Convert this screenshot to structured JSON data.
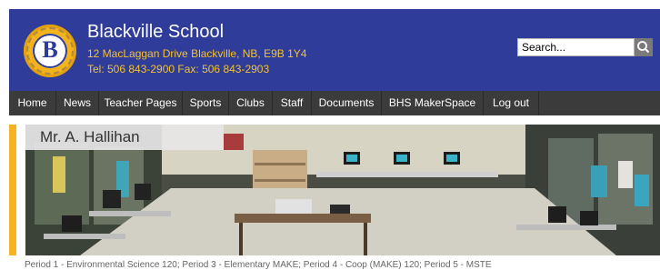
{
  "header": {
    "school_name": "Blackville School",
    "address": "12 MacLaggan Drive Blackville, NB, E9B 1Y4",
    "phone": "Tel: 506 843-2900 Fax: 506 843-2903",
    "logo_icon": "school-crest-icon",
    "search": {
      "placeholder": "Search...",
      "value": "Search..."
    }
  },
  "nav": {
    "items": [
      {
        "label": "Home"
      },
      {
        "label": "News"
      },
      {
        "label": "Teacher Pages"
      },
      {
        "label": "Sports"
      },
      {
        "label": "Clubs"
      },
      {
        "label": "Staff"
      },
      {
        "label": "Documents"
      },
      {
        "label": "BHS MakerSpace"
      },
      {
        "label": "Log out"
      }
    ]
  },
  "banner": {
    "title": "Mr. A. Hallihan",
    "subtitle": "Period 1 - Environmental Science 120; Period 3 - Elementary MAKE; Period 4 - Coop (MAKE) 120; Period 5 - MSTE"
  },
  "colors": {
    "header_bg": "#2f3c99",
    "header_text": "#ffffff",
    "contact_text": "#f1c232",
    "nav_bg": "#3b3b3b",
    "accent": "#f5b324"
  }
}
